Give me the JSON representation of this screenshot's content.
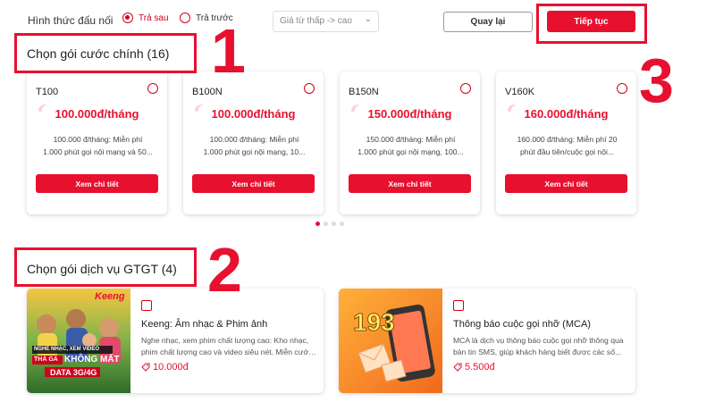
{
  "topbar": {
    "connection_label": "Hình thức đấu nối",
    "option_postpaid": "Trả sau",
    "option_prepaid": "Trả trước",
    "selected_option": "Trả sau",
    "sort_value": "Giá từ thấp -> cao",
    "back_label": "Quay lại",
    "continue_label": "Tiếp tục"
  },
  "main_plans": {
    "title": "Chọn gói cước chính (16)",
    "detail_label": "Xem chi tiết",
    "active_page_index": 0,
    "page_count": 4,
    "items": [
      {
        "code": "T100",
        "price": "100.000đ",
        "per": "/tháng",
        "desc1": "100.000 đ/tháng: Miễn phí",
        "desc2": "1.000 phút gọi nội mạng và 50..."
      },
      {
        "code": "B100N",
        "price": "100.000đ",
        "per": "/tháng",
        "desc1": "100.000 đ/tháng: Miễn phí",
        "desc2": "1.000 phút gọi nội mạng, 10..."
      },
      {
        "code": "B150N",
        "price": "150.000đ",
        "per": "/tháng",
        "desc1": "150.000 đ/tháng: Miễn phí",
        "desc2": "1.000 phút gọi nội mạng, 100..."
      },
      {
        "code": "V160K",
        "price": "160.000đ",
        "per": "/tháng",
        "desc1": "160.000 đ/tháng: Miễn phí 20",
        "desc2": "phút đầu tiên/cuộc gọi nội..."
      }
    ]
  },
  "vas": {
    "title": "Chọn gói dịch vụ GTGT (4)",
    "items": [
      {
        "name": "Keeng: Âm nhạc & Phim ảnh",
        "desc1": "Nghe nhạc, xem phim chất lượng cao: Kho nhạc,",
        "desc2": "phim chất lượng cao và video siêu nét. Miễn cước...",
        "price": "10.000đ",
        "banner_line1": "NGHE NHẠC, XEM VIDEO",
        "banner_line2a": "THẢ GA",
        "banner_line2b": "KHÔNG MẤT",
        "banner_line3": "DATA 3G/4G",
        "logo": "Keeng"
      },
      {
        "name": "Thông báo cuộc gọi nhỡ (MCA)",
        "desc1": "MCA là dịch vụ thông báo cuộc gọi nhỡ thông qua",
        "desc2": "bản tin SMS, giúp khách hàng biết được các số...",
        "price": "5.500đ",
        "badge": "193"
      }
    ]
  },
  "annotations": {
    "n1": "1",
    "n2": "2",
    "n3": "3"
  },
  "colors": {
    "accent": "#e8102f",
    "annotation": "#e8102f"
  },
  "icons": {
    "radio": "radio-icon",
    "chevron": "chevron-down-icon",
    "tag": "price-tag-icon",
    "logo": "brand-swirl-icon"
  }
}
